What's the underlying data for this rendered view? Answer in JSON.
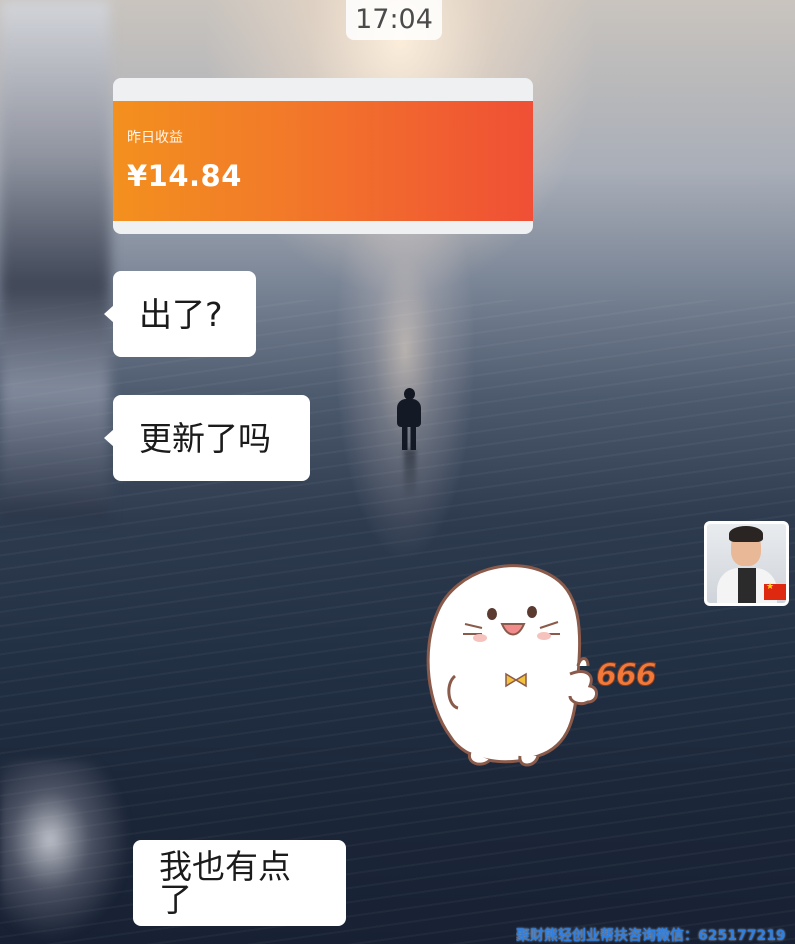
{
  "status": {
    "time": "17:04"
  },
  "earnings_card": {
    "label": "昨日收益",
    "amount": "¥14.84"
  },
  "messages": [
    {
      "text": "出了?"
    },
    {
      "text": "更新了吗"
    },
    {
      "text": "我也有点了"
    }
  ],
  "sticker": {
    "caption": "666"
  },
  "watermark": {
    "text": "聚财熊轻创业帮扶咨询微信：625177219"
  },
  "colors": {
    "card_gradient_start": "#f3901e",
    "card_gradient_end": "#f04f35",
    "bubble": "#ffffff",
    "watermark": "#2f7fe0",
    "sticker_caption": "#f2793a"
  }
}
